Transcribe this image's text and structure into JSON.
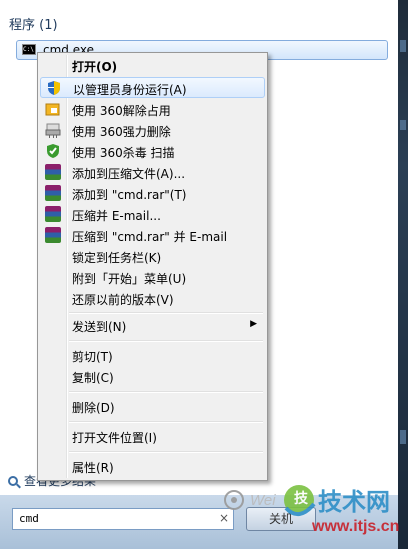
{
  "start_menu": {
    "section_title": "程序 (1)",
    "program": {
      "label": "cmd.exe",
      "icon": "cmd-icon",
      "icon_text": "C:\\"
    },
    "see_more": "查看更多结果",
    "search": {
      "value": "cmd",
      "clear": "×"
    },
    "shutdown_label": "关机"
  },
  "watermark": {
    "logo_char": "技",
    "brand": "技术网",
    "url": "www.itjs.cn",
    "sub": "Wei"
  },
  "context_menu": {
    "items": [
      {
        "label": "打开(O)",
        "bold": true,
        "icon": ""
      },
      {
        "label": "以管理员身份运行(A)",
        "highlighted": true,
        "icon": "uac-shield-icon"
      },
      {
        "label": "使用 360解除占用",
        "icon": "360-unlock-icon"
      },
      {
        "label": "使用 360强力删除",
        "icon": "360-shredder-icon"
      },
      {
        "label": "使用 360杀毒 扫描",
        "icon": "360-antivirus-icon"
      },
      {
        "label": "添加到压缩文件(A)...",
        "icon": "winrar-icon"
      },
      {
        "label": "添加到 \"cmd.rar\"(T)",
        "icon": "winrar-icon"
      },
      {
        "label": "压缩并 E-mail...",
        "icon": "winrar-icon"
      },
      {
        "label": "压缩到 \"cmd.rar\" 并 E-mail",
        "icon": "winrar-icon"
      },
      {
        "label": "锁定到任务栏(K)",
        "icon": ""
      },
      {
        "label": "附到「开始」菜单(U)",
        "icon": ""
      },
      {
        "label": "还原以前的版本(V)",
        "icon": ""
      },
      {
        "label": "发送到(N)",
        "icon": "",
        "submenu": true,
        "arrow": "▶"
      },
      {
        "label": "剪切(T)",
        "icon": ""
      },
      {
        "label": "复制(C)",
        "icon": ""
      },
      {
        "label": "删除(D)",
        "icon": ""
      },
      {
        "label": "打开文件位置(I)",
        "icon": ""
      },
      {
        "label": "属性(R)",
        "icon": ""
      }
    ]
  },
  "colors": {
    "highlight_border": "#aecff7",
    "menu_bg": "#f0f0f0",
    "title_text": "#1e395b"
  }
}
